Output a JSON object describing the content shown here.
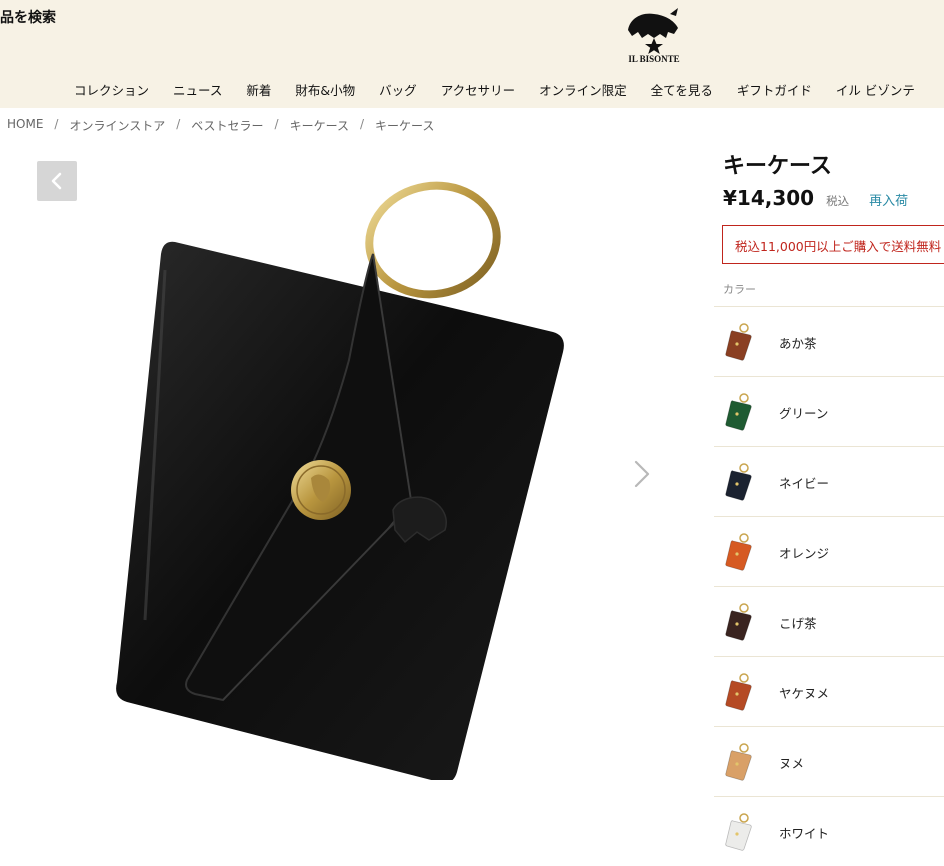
{
  "header": {
    "search_label": "商品を検索",
    "logo_text": "IL BISONTE",
    "nav": [
      "コレクション",
      "ニュース",
      "新着",
      "財布&小物",
      "バッグ",
      "アクセサリー",
      "オンライン限定",
      "全てを見る",
      "ギフトガイド",
      "イル ビゾンテ"
    ]
  },
  "breadcrumb": [
    "HOME",
    "オンラインストア",
    "ベストセラー",
    "キーケース",
    "キーケース"
  ],
  "breadcrumb_separator": "/",
  "product": {
    "title": "キーケース",
    "price": "¥14,300",
    "tax_label": "税込",
    "restock_label": "再入荷",
    "shipping_notice": "税込11,000円以上ご購入で送料無料",
    "color_label": "カラー",
    "colors": [
      {
        "name": "あか茶",
        "hex": "#8a3f22"
      },
      {
        "name": "グリーン",
        "hex": "#1f5b32"
      },
      {
        "name": "ネイビー",
        "hex": "#1b2230"
      },
      {
        "name": "オレンジ",
        "hex": "#d65a22"
      },
      {
        "name": "こげ茶",
        "hex": "#3a2420"
      },
      {
        "name": "ヤケヌメ",
        "hex": "#b54a24"
      },
      {
        "name": "ヌメ",
        "hex": "#d9a067"
      },
      {
        "name": "ホワイト",
        "hex": "#ececea"
      }
    ]
  },
  "icons": {
    "prev": "chevron-left-icon",
    "next": "chevron-right-icon"
  }
}
